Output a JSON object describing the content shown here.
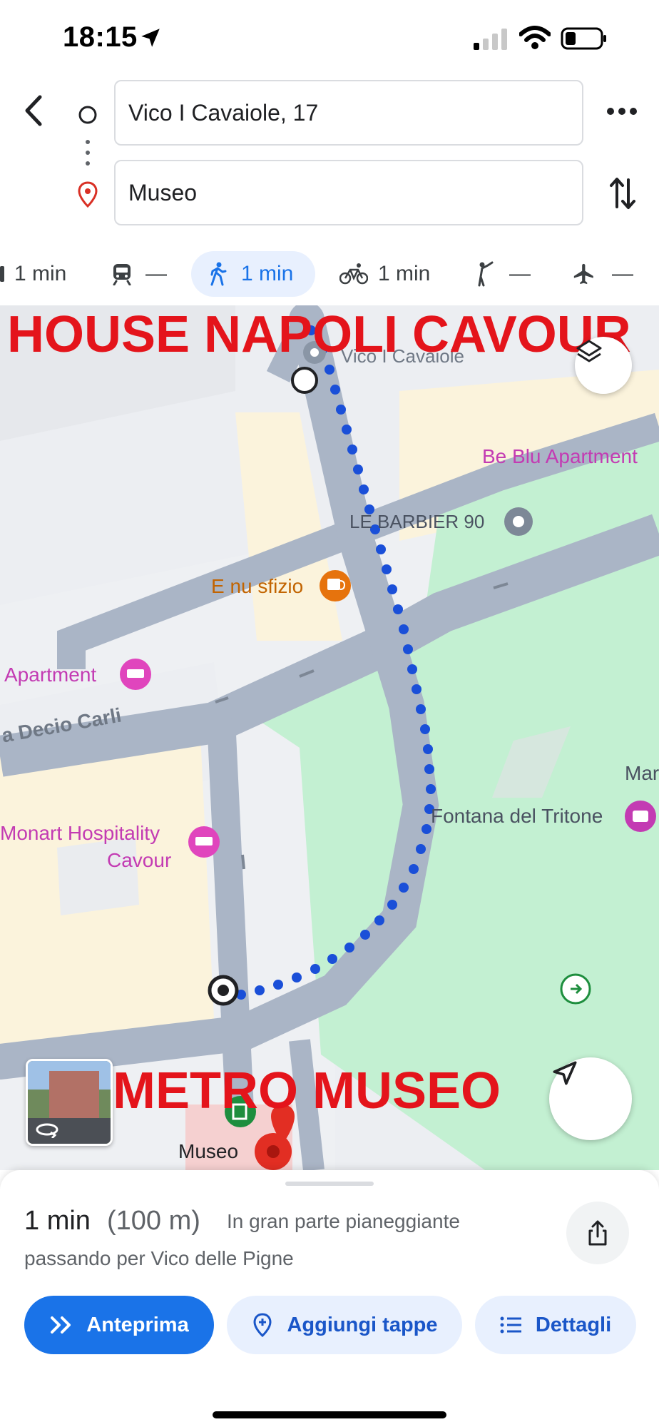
{
  "status_bar": {
    "time": "18:15"
  },
  "directions": {
    "origin": "Vico I Cavaiole, 17",
    "destination": "Museo"
  },
  "modes": [
    {
      "id": "car",
      "label": "1 min"
    },
    {
      "id": "transit",
      "label": "—"
    },
    {
      "id": "walk",
      "label": "1 min",
      "active": true
    },
    {
      "id": "bike",
      "label": "1 min"
    },
    {
      "id": "rideshare",
      "label": "—"
    },
    {
      "id": "flight",
      "label": "—"
    }
  ],
  "map": {
    "overlay_top": "HOUSE NAPOLI CAVOUR",
    "overlay_bottom": "METRO MUSEO",
    "labels": {
      "vico_cavaiole": "Vico I Cavaiole",
      "be_blu": "Be Blu Apartment",
      "barbier": "LE BARBIER 90",
      "nu_sfizio": "E nu sfizio",
      "apartment": "Apartment",
      "decio_carli": "a Decio Carli",
      "mar": "Mar",
      "fontana": "Fontana del Tritone",
      "monart_line1": "Monart Hospitality",
      "monart_line2": "Cavour",
      "museo": "Museo"
    },
    "colors": {
      "route": "#1a4fd8",
      "park": "#c3f0d2",
      "road": "#aab5c6",
      "building": "#fbf3dc",
      "poi_pink": "#c33bb3",
      "poi_orange": "#c26401"
    }
  },
  "summary": {
    "duration": "1 min",
    "distance": "(100 m)",
    "terrain": "In gran parte pianeggiante",
    "via": "passando per Vico delle Pigne"
  },
  "actions": {
    "preview": "Anteprima",
    "add_stops": "Aggiungi tappe",
    "details": "Dettagli"
  }
}
